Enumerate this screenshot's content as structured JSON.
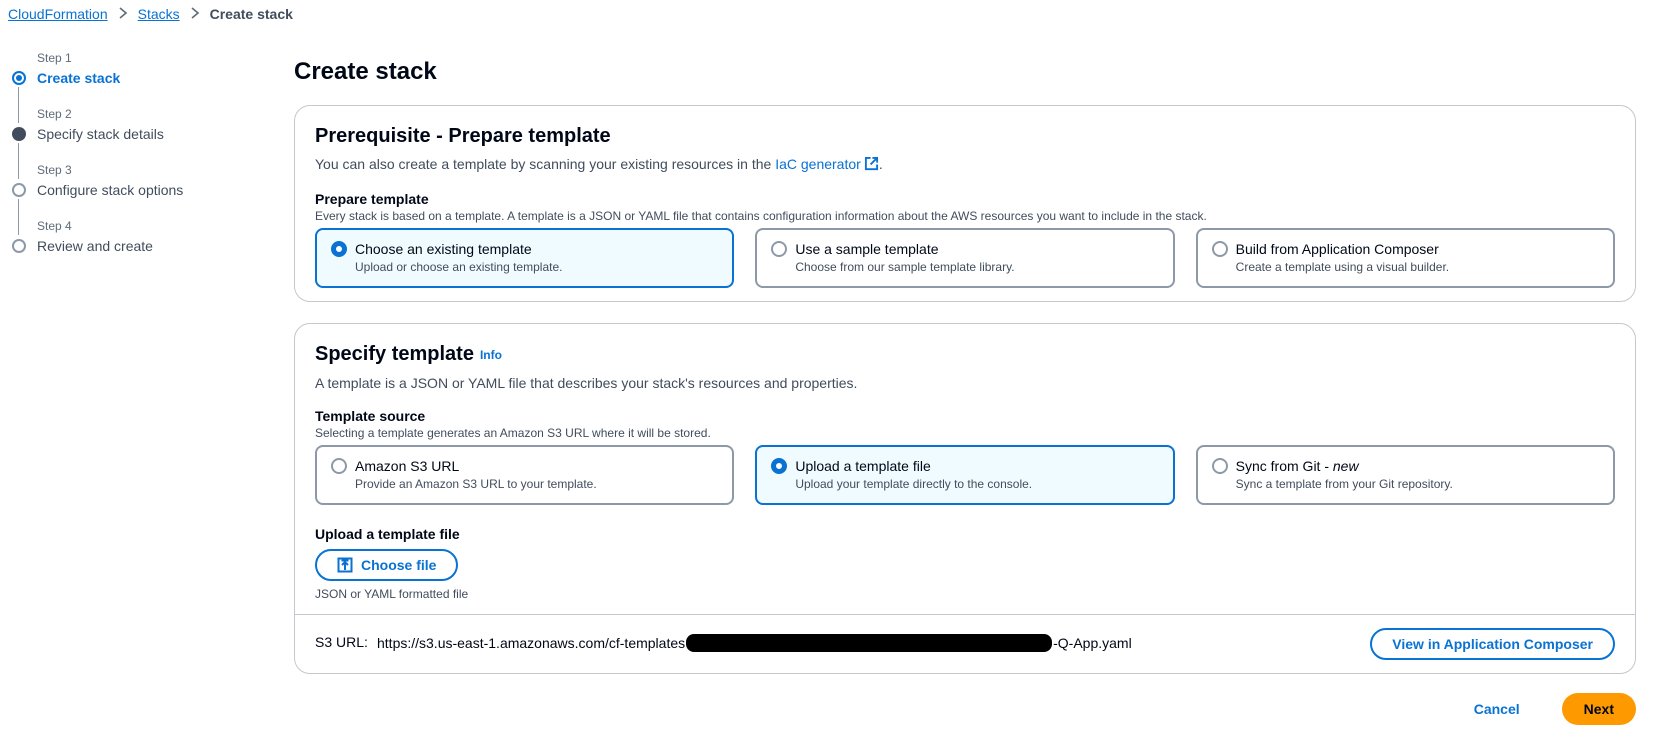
{
  "breadcrumb": {
    "root": "CloudFormation",
    "stacks": "Stacks",
    "current": "Create stack"
  },
  "steps": [
    {
      "num": "Step 1",
      "title": "Create stack"
    },
    {
      "num": "Step 2",
      "title": "Specify stack details"
    },
    {
      "num": "Step 3",
      "title": "Configure stack options"
    },
    {
      "num": "Step 4",
      "title": "Review and create"
    }
  ],
  "page_title": "Create stack",
  "prereq": {
    "title": "Prerequisite - Prepare template",
    "desc_prefix": "You can also create a template by scanning your existing resources in the",
    "link": "IaC generator",
    "desc_suffix": ".",
    "label": "Prepare template",
    "sublabel": "Every stack is based on a template. A template is a JSON or YAML file that contains configuration information about the AWS resources you want to include in the stack.",
    "options": [
      {
        "title": "Choose an existing template",
        "desc": "Upload or choose an existing template."
      },
      {
        "title": "Use a sample template",
        "desc": "Choose from our sample template library."
      },
      {
        "title": "Build from Application Composer",
        "desc": "Create a template using a visual builder."
      }
    ]
  },
  "specify": {
    "title": "Specify template",
    "info": "Info",
    "desc": "A template is a JSON or YAML file that describes your stack's resources and properties.",
    "label": "Template source",
    "sublabel": "Selecting a template generates an Amazon S3 URL where it will be stored.",
    "options": [
      {
        "title": "Amazon S3 URL",
        "desc": "Provide an Amazon S3 URL to your template."
      },
      {
        "title": "Upload a template file",
        "desc": "Upload your template directly to the console."
      },
      {
        "title": "Sync from Git - ",
        "title_em": "new",
        "desc": "Sync a template from your Git repository."
      }
    ],
    "upload_label": "Upload a template file",
    "choose_file": "Choose file",
    "hint": "JSON or YAML formatted file",
    "s3_label": "S3 URL:",
    "s3_url_prefix": "https://s3.us-east-1.amazonaws.com/cf-templates",
    "s3_url_suffix": "-Q-App.yaml",
    "view_button": "View in Application Composer"
  },
  "footer": {
    "cancel": "Cancel",
    "next": "Next"
  },
  "colors": {
    "accent": "#0972d3",
    "primary_button": "#ff9900"
  }
}
